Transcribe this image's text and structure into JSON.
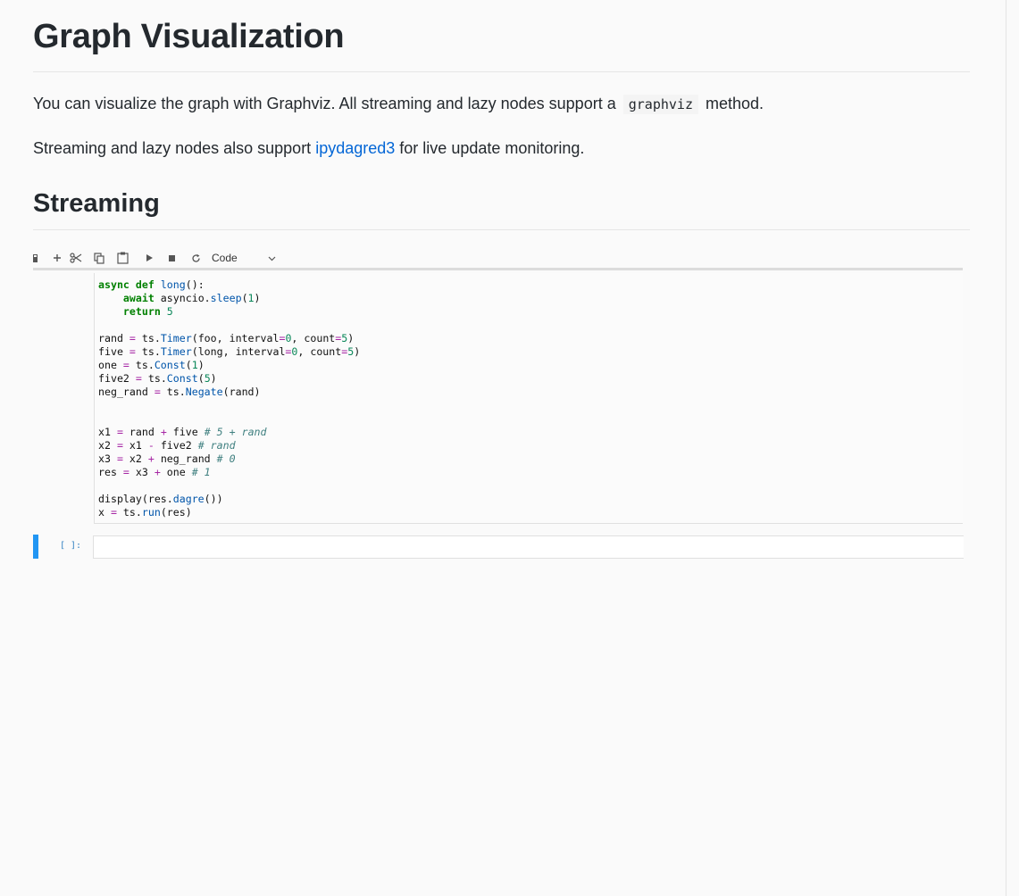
{
  "page": {
    "title": "Graph Visualization",
    "intro": {
      "before": "You can visualize the graph with Graphviz. All streaming and lazy nodes support a",
      "code": "graphviz",
      "after": "method."
    },
    "monitoring": {
      "before": "Streaming and lazy nodes also support",
      "link": "ipydagred3",
      "after": "for live update monitoring."
    },
    "section_heading": "Streaming"
  },
  "toolbar": {
    "buttons": [
      {
        "name": "save-icon"
      },
      {
        "name": "add-cell-icon"
      },
      {
        "name": "cut-icon"
      },
      {
        "name": "copy-icon"
      },
      {
        "name": "paste-icon"
      },
      {
        "name": "run-icon"
      },
      {
        "name": "stop-icon"
      },
      {
        "name": "restart-icon"
      }
    ],
    "cell_type": "Code",
    "dropdown_icon": "chevron-down-icon"
  },
  "cell": {
    "code_lines": [
      "async def long():",
      "    await asyncio.sleep(1)",
      "    return 5",
      "",
      "rand = ts.Timer(foo, interval=0, count=5)",
      "five = ts.Timer(long, interval=0, count=5)",
      "one = ts.Const(1)",
      "five2 = ts.Const(5)",
      "neg_rand = ts.Negate(rand)",
      "",
      "",
      "x1 = rand + five # 5 + rand",
      "x2 = x1 - five2 # rand",
      "x3 = x2 + neg_rand # 0",
      "res = x3 + one # 1",
      "",
      "display(res.dagre())",
      "x = ts.run(res)"
    ]
  },
  "empty_cell": {
    "prompt": "[ ]:"
  },
  "colors": {
    "accent": "#2196f3",
    "link": "#0366d6",
    "keyword": "#008000",
    "function": "#0055aa",
    "number": "#098658",
    "operator": "#a626a4",
    "comment": "#408080"
  }
}
